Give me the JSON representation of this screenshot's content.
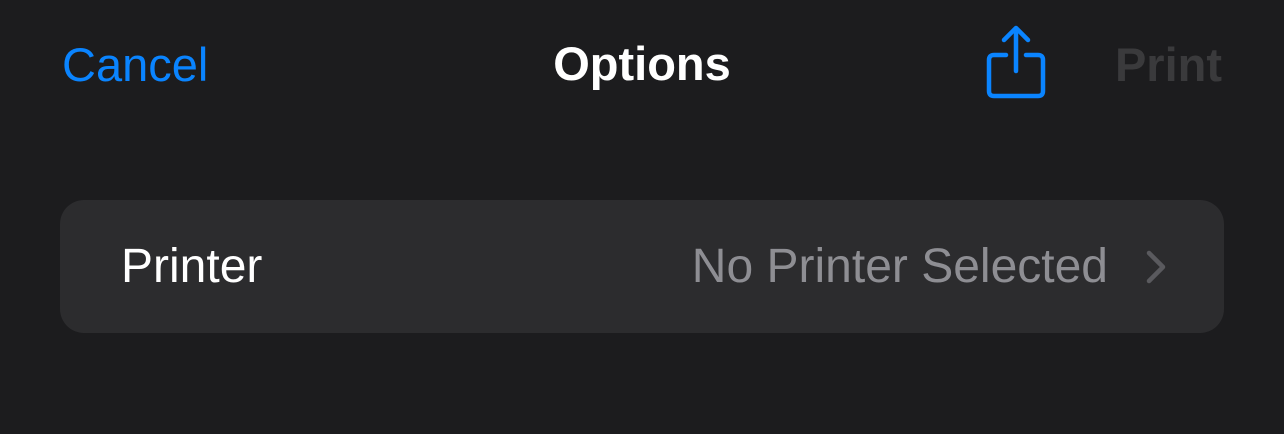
{
  "nav": {
    "cancel_label": "Cancel",
    "title": "Options",
    "share_icon": "share-icon",
    "print_label": "Print",
    "print_enabled": false
  },
  "printer": {
    "label": "Printer",
    "value": "No Printer Selected",
    "chevron_icon": "chevron-right-icon"
  },
  "colors": {
    "background": "#1c1c1e",
    "row_background": "#2c2c2e",
    "accent": "#0a84ff",
    "primary_text": "#ffffff",
    "secondary_text": "#8e8e93",
    "disabled_text": "#3a3a3c",
    "chevron": "#5a5a5e"
  }
}
